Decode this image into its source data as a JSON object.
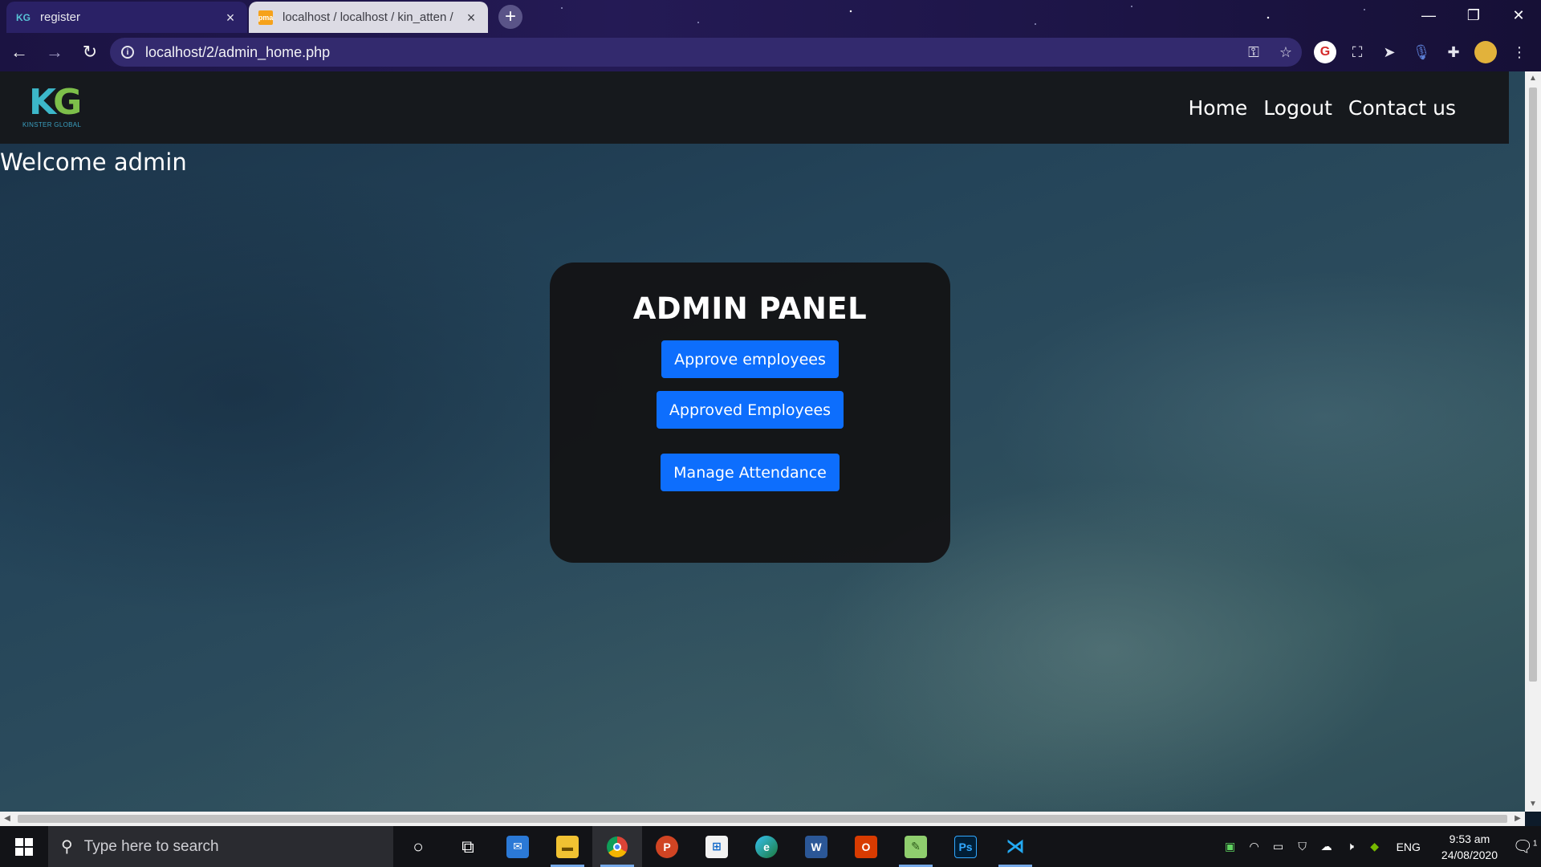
{
  "browser": {
    "tabs": [
      {
        "label": "register",
        "favicon": "KG"
      },
      {
        "label": "localhost / localhost / kin_atten /",
        "favicon": "pma"
      }
    ],
    "new_tab_icon": "+",
    "address": "localhost/2/admin_home.php",
    "window_controls": {
      "minimize": "—",
      "restore": "❐",
      "close": "✕"
    }
  },
  "site": {
    "logo_mark_k": "K",
    "logo_mark_g": "G",
    "logo_text": "KINSTER GLOBAL",
    "nav": [
      {
        "label": "Home"
      },
      {
        "label": "Logout"
      },
      {
        "label": "Contact us"
      }
    ],
    "welcome": "Welcome admin"
  },
  "panel": {
    "title": "ADMIN PANEL",
    "buttons": [
      {
        "label": "Approve employees"
      },
      {
        "label": "Approved Employees"
      },
      {
        "label": "Manage Attendance"
      }
    ]
  },
  "taskbar": {
    "search_placeholder": "Type here to search",
    "apps": [
      "cortana",
      "task-view",
      "mail",
      "file-explorer",
      "chrome",
      "powerpoint",
      "store",
      "edge",
      "word",
      "office",
      "notepad-plus",
      "photoshop",
      "vscode"
    ],
    "language": "ENG",
    "time": "9:53 am",
    "date": "24/08/2020",
    "notification_count": "1"
  },
  "colors": {
    "accent_button": "#0d6efd",
    "navbar": "#16191d",
    "panel": "#141416"
  }
}
